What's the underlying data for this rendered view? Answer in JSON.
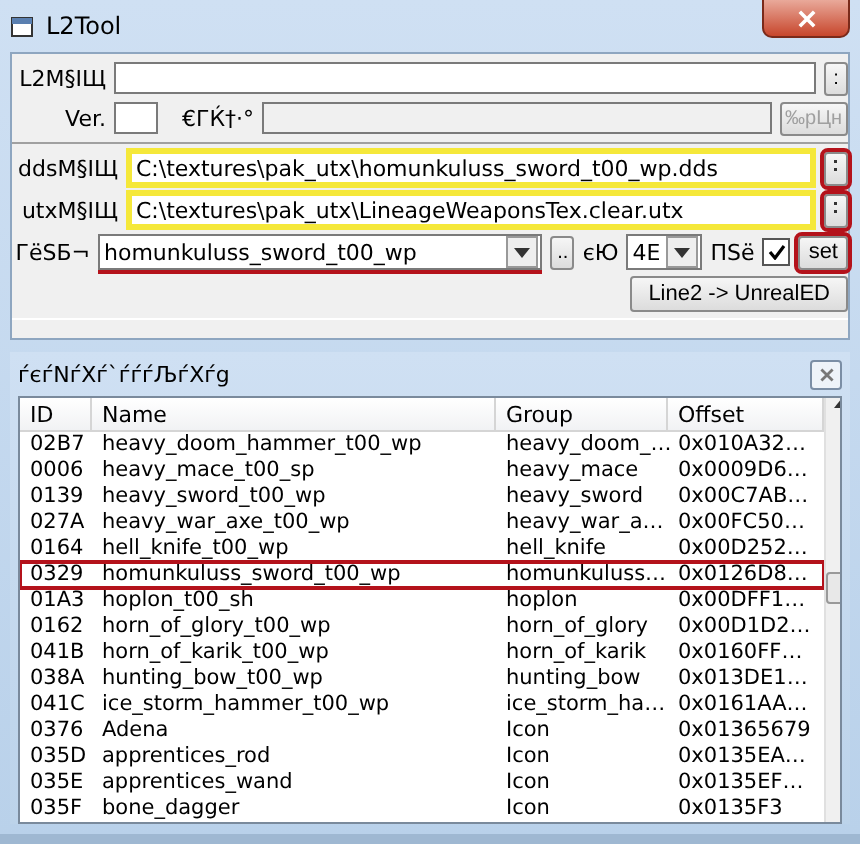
{
  "window": {
    "title": "L2Tool"
  },
  "form": {
    "l2_path": {
      "label": "L2M§IЩ",
      "button": ":"
    },
    "version": {
      "label": "Ver.",
      "label_2": "€ГЌ†·°",
      "button": "‰pЦн",
      "disabled": true
    },
    "dds": {
      "label": "ddsM§IЩ",
      "value": "C:\\textures\\pak_utx\\homunkuluss_sword_t00_wp.dds",
      "highlighted": true,
      "button_highlighted": true
    },
    "utx": {
      "label": "utxM§IЩ",
      "value": "C:\\textures\\pak_utx\\LineageWeaponsTex.clear.utx",
      "highlighted": true,
      "button_highlighted": true
    },
    "texture": {
      "label": "ГёЅБ¬",
      "value": "homunkuluss_sword_t00_wp",
      "highlighted": true,
      "browse": "..",
      "format_label": "єЮ",
      "format": "4E",
      "alpha_label": "ПЅё",
      "alpha_checked": true,
      "set_button": "set",
      "set_highlighted": true
    },
    "convert_button": "Line2 -> UnrealED"
  },
  "list_panel": {
    "title": "ѓєѓNѓXѓ`ѓѓѓЉѓXѓg",
    "columns": [
      "ID",
      "Name",
      "Group",
      "Offset"
    ],
    "rows": [
      {
        "id": "02B7",
        "name": "heavy_doom_hammer_t00_wp",
        "group": "heavy_doom_…",
        "offset": "0x010A32…",
        "selected": false
      },
      {
        "id": "0006",
        "name": "heavy_mace_t00_sp",
        "group": "heavy_mace",
        "offset": "0x0009D6…",
        "selected": false
      },
      {
        "id": "0139",
        "name": "heavy_sword_t00_wp",
        "group": "heavy_sword",
        "offset": "0x00C7AB…",
        "selected": false
      },
      {
        "id": "027A",
        "name": "heavy_war_axe_t00_wp",
        "group": "heavy_war_a…",
        "offset": "0x00FC50…",
        "selected": false
      },
      {
        "id": "0164",
        "name": "hell_knife_t00_wp",
        "group": "hell_knife",
        "offset": "0x00D252…",
        "selected": false
      },
      {
        "id": "0329",
        "name": "homunkuluss_sword_t00_wp",
        "group": "homunkuluss…",
        "offset": "0x0126D8…",
        "selected": true
      },
      {
        "id": "01A3",
        "name": "hoplon_t00_sh",
        "group": "hoplon",
        "offset": "0x00DFF1…",
        "selected": false
      },
      {
        "id": "0162",
        "name": "horn_of_glory_t00_wp",
        "group": "horn_of_glory",
        "offset": "0x00D1D2…",
        "selected": false
      },
      {
        "id": "041B",
        "name": "horn_of_karik_t00_wp",
        "group": "horn_of_karik",
        "offset": "0x0160FF…",
        "selected": false
      },
      {
        "id": "038A",
        "name": "hunting_bow_t00_wp",
        "group": "hunting_bow",
        "offset": "0x013DE1…",
        "selected": false
      },
      {
        "id": "041C",
        "name": "ice_storm_hammer_t00_wp",
        "group": "ice_storm_ha…",
        "offset": "0x0161AA…",
        "selected": false
      },
      {
        "id": "0376",
        "name": "Adena",
        "group": "Icon",
        "offset": "0x01365679",
        "selected": false
      },
      {
        "id": "035D",
        "name": "apprentices_rod",
        "group": "Icon",
        "offset": "0x0135EA…",
        "selected": false
      },
      {
        "id": "035E",
        "name": "apprentices_wand",
        "group": "Icon",
        "offset": "0x0135EF…",
        "selected": false
      },
      {
        "id": "035F",
        "name": "bone_dagger",
        "group": "Icon",
        "offset": "0x0135F3",
        "selected": false
      }
    ]
  }
}
